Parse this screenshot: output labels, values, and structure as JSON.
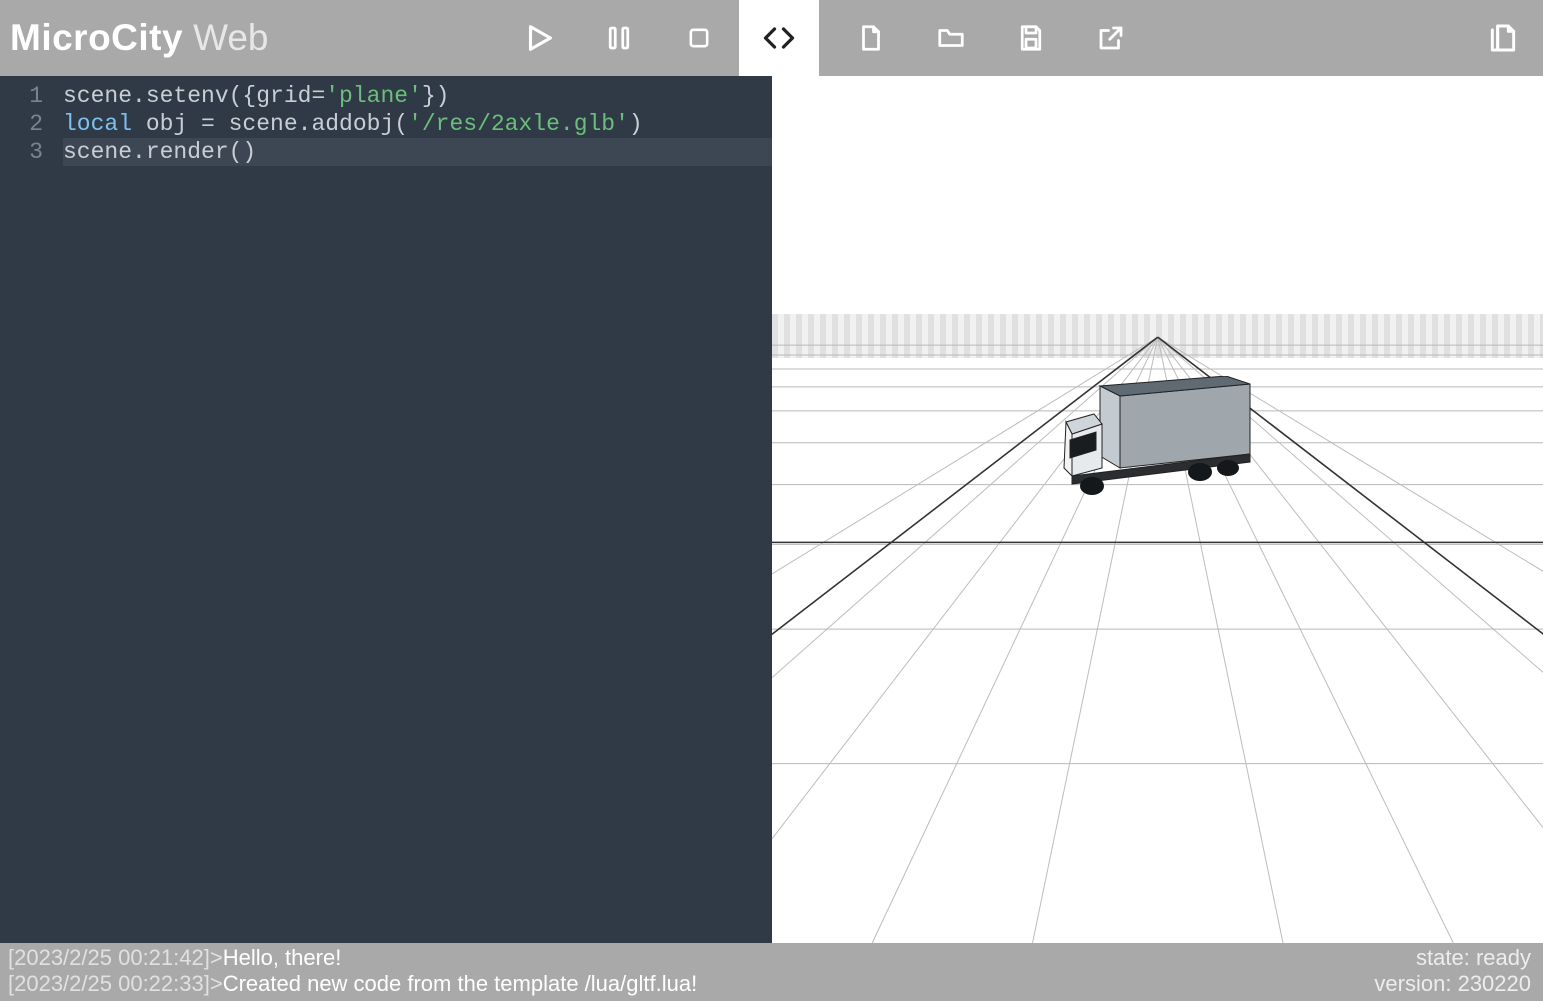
{
  "brand": {
    "main": "MicroCity",
    "sub": "Web"
  },
  "toolbar": {
    "play": "play-icon",
    "pause": "pause-icon",
    "stop": "stop-icon",
    "code": "code-icon",
    "new": "file-icon",
    "open": "folder-icon",
    "save": "save-icon",
    "share": "share-icon",
    "docs": "docs-icon"
  },
  "editor": {
    "lines": [
      {
        "n": "1"
      },
      {
        "n": "2"
      },
      {
        "n": "3"
      }
    ],
    "code": {
      "l1": {
        "a": "scene.setenv({grid=",
        "b": "'plane'",
        "c": "})"
      },
      "l2": {
        "a": "local",
        "b": " obj = scene.addobj(",
        "c": "'/res/2axle.glb'",
        "d": ")"
      },
      "l3": {
        "a": "scene.render()"
      }
    }
  },
  "console": {
    "rows": [
      {
        "ts": "[2023/2/25 00:21:42]>",
        "msg": "Hello, there!",
        "right_label": "state: ",
        "right_val": "ready"
      },
      {
        "ts": "[2023/2/25 00:22:33]>",
        "msg": "Created new code from the template /lua/gltf.lua!",
        "right_label": "version: ",
        "right_val": "230220"
      }
    ]
  }
}
